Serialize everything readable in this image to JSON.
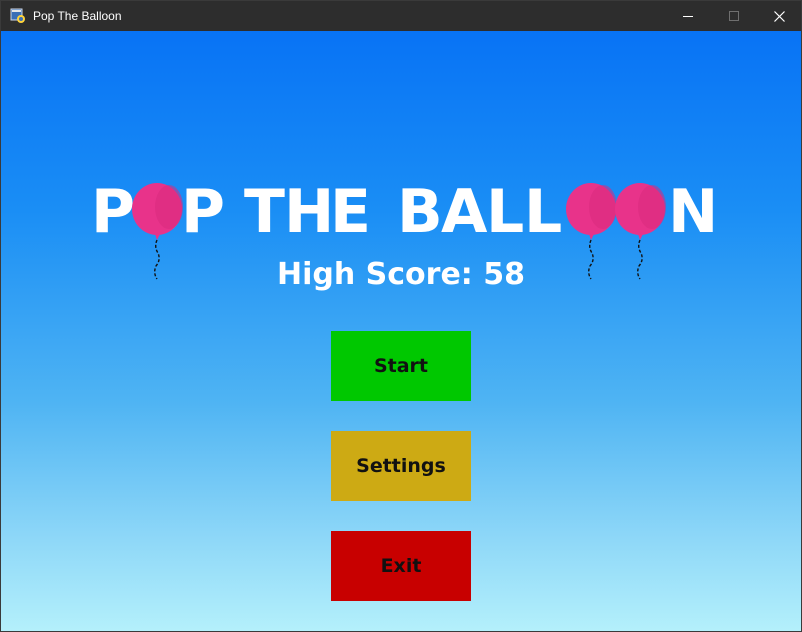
{
  "window": {
    "title": "Pop The Balloon"
  },
  "game": {
    "title_chars": [
      "P",
      "O",
      "P",
      " ",
      "T",
      "H",
      "E",
      " ",
      "B",
      "A",
      "L",
      "L",
      "O",
      "O",
      "N"
    ],
    "high_score_label": "High Score: 58",
    "high_score": 58,
    "balloon_color": "#e8338a"
  },
  "menu": {
    "start_label": "Start",
    "settings_label": "Settings",
    "exit_label": "Exit"
  },
  "colors": {
    "start": "#00c800",
    "settings": "#cdaa14",
    "exit": "#c80000",
    "sky_top": "#0873f5",
    "sky_bottom": "#b4f0fb"
  },
  "icons": [
    "python-app-icon",
    "minimize-icon",
    "maximize-icon",
    "close-icon",
    "balloon-icon"
  ]
}
